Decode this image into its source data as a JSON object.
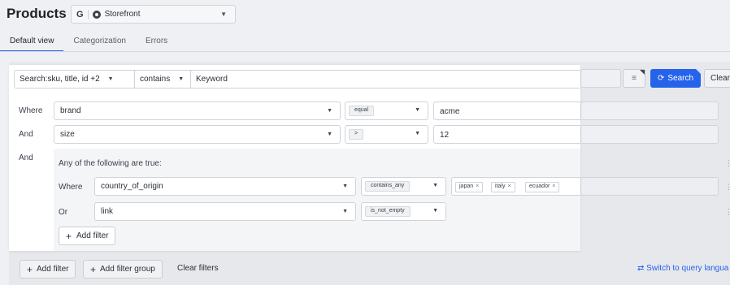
{
  "header": {
    "title": "Products",
    "store_initial": "G",
    "store_name": "Storefront"
  },
  "tabs": [
    {
      "label": "Default view"
    },
    {
      "label": "Categorization"
    },
    {
      "label": "Errors"
    }
  ],
  "search": {
    "fields_label_prefix": "Search: ",
    "fields_value": "sku, title, id +2",
    "operator": "contains",
    "keyword_placeholder": "Keyword",
    "search_button": "Search",
    "clear_button": "Clear"
  },
  "filters": {
    "row1": {
      "connector": "Where",
      "field": "brand",
      "operator": "equal",
      "value": "acme"
    },
    "row2": {
      "connector": "And",
      "field": "size",
      "operator": ">",
      "value": "12"
    },
    "group": {
      "connector": "And",
      "title": "Any of the following are true:",
      "row1": {
        "connector": "Where",
        "field": "country_of_origin",
        "operator": "contains_any",
        "tags": [
          "japan",
          "italy",
          "ecuador"
        ]
      },
      "row2": {
        "connector": "Or",
        "field": "link",
        "operator": "is_not_empty"
      },
      "add_filter": "Add filter"
    }
  },
  "footer": {
    "add_filter": "Add filter",
    "add_filter_group": "Add filter group",
    "clear_filters": "Clear filters",
    "switch_language": "Switch to query langua"
  },
  "colors": {
    "accent": "#2563eb"
  }
}
